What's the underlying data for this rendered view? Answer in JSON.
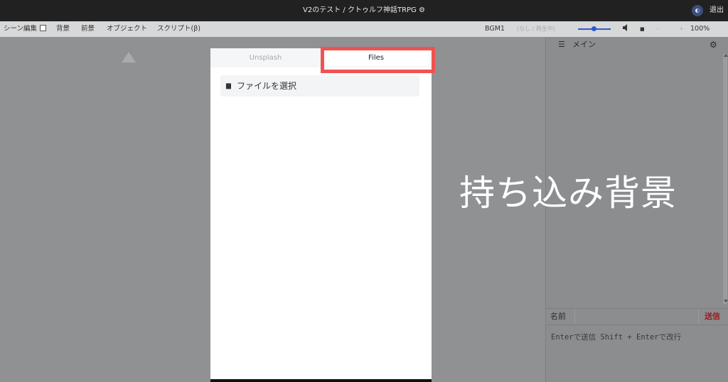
{
  "window": {
    "title": "V2のテスト / クトゥルフ神話TRPG ⚙",
    "avatar_glyph": "◐",
    "exit_label": "退出"
  },
  "menubar": {
    "scene_edit_label": "シーン編集",
    "background_label": "背景",
    "foreground_label": "前景",
    "objects_label": "オブジェクト",
    "script_label": "スクリプト(β)",
    "bgm_label": "BGM1",
    "bgm_status": "(なし / 再生中)",
    "volume_icon": "speaker-icon",
    "stop_glyph": "■",
    "zoom_minus": "-",
    "zoom_plus": "+",
    "zoom_level": "100%"
  },
  "chat": {
    "tab_label": "メイン",
    "list_icon": "☰",
    "gear_icon": "⚙",
    "name_label": "名前",
    "name_value": "",
    "send_label": "送信",
    "message_placeholder": "Enterで送信 Shift + Enterで改行"
  },
  "dialog": {
    "tabs": [
      {
        "label": "Unsplash",
        "active": false
      },
      {
        "label": "Files",
        "active": true
      }
    ],
    "select_file_label": "ファイルを選択",
    "folder_glyph": "▆"
  },
  "overlay": {
    "caption": "持ち込み背景"
  },
  "colors": {
    "highlight": "#ef5350",
    "send": "#a01818",
    "slider": "#2a5cc8"
  }
}
